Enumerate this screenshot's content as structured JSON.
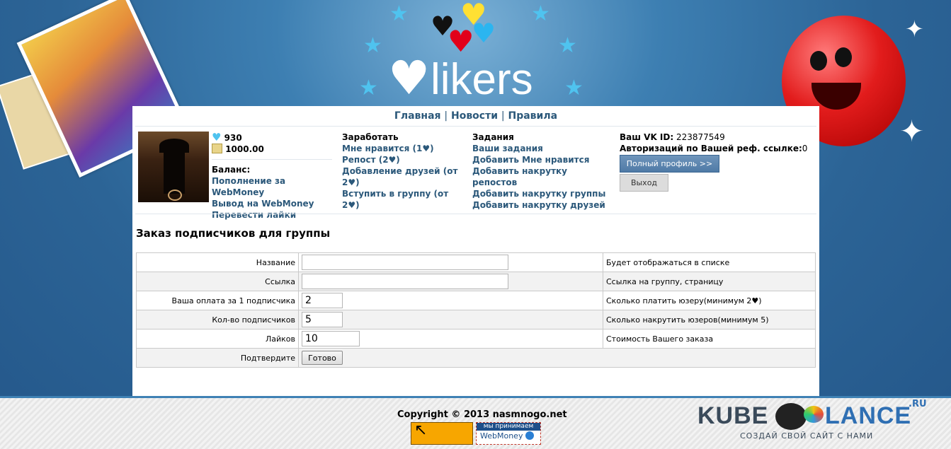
{
  "header": {
    "logo_text": "likers",
    "nav": {
      "home": "Главная",
      "news": "Новости",
      "rules": "Правила",
      "sep": "|"
    }
  },
  "user": {
    "likes": "930",
    "money": "1000.00",
    "balance_label": "Баланс:",
    "balance_links": [
      "Пополнение за WebMoney",
      "Вывод на WebMoney",
      "Перевести лайки"
    ],
    "vk_id_label": "Ваш VK ID:",
    "vk_id": "223877549",
    "ref_label": "Авторизаций по Вашей реф. ссылке:",
    "ref_count": "0",
    "profile_button": "Полный профиль >>",
    "logout_button": "Выход"
  },
  "earn": {
    "title": "Заработать",
    "links": [
      "Мне нравится (1♥)",
      "Репост (2♥)",
      "Добавление друзей (от 2♥)",
      "Вступить в группу (от 2♥)"
    ]
  },
  "tasks": {
    "title": "Задания",
    "links": [
      "Ваши задания",
      "Добавить Мне нравится",
      "Добавить накрутку репостов",
      "Добавить накрутку группы",
      "Добавить накрутку друзей"
    ]
  },
  "form": {
    "title": "Заказ подписчиков для группы",
    "rows": [
      {
        "label": "Название",
        "value": "",
        "hint": "Будет отображаться в списке"
      },
      {
        "label": "Ссылка",
        "value": "",
        "hint": "Ссылка на группу, страницу"
      },
      {
        "label": "Ваша оплата за 1 подписчика",
        "value": "2",
        "hint": "Сколько платить юзеру(минимум 2♥)"
      },
      {
        "label": "Кол-во подписчиков",
        "value": "5",
        "hint": "Сколько накрутить юзеров(минимум 5)"
      },
      {
        "label": "Лайков",
        "value": "10",
        "hint": "Стоимость Вашего заказа"
      }
    ],
    "confirm_label": "Подтвердите",
    "submit": "Готово"
  },
  "footer": {
    "copyright": "Copyright © 2013 nasmnogo.net",
    "wm_top": "мы принимаем",
    "wm_bottom": "WebMoney",
    "kube_left": "KUBE",
    "kube_right": "LANCE",
    "kube_ru": ".RU",
    "kube_slogan": "СОЗДАЙ СВОЙ САЙТ С НАМИ"
  },
  "colors": {
    "link": "#2b587a",
    "accent_blue": "#4f7aa6",
    "heart_blue": "#4fc3ef"
  }
}
